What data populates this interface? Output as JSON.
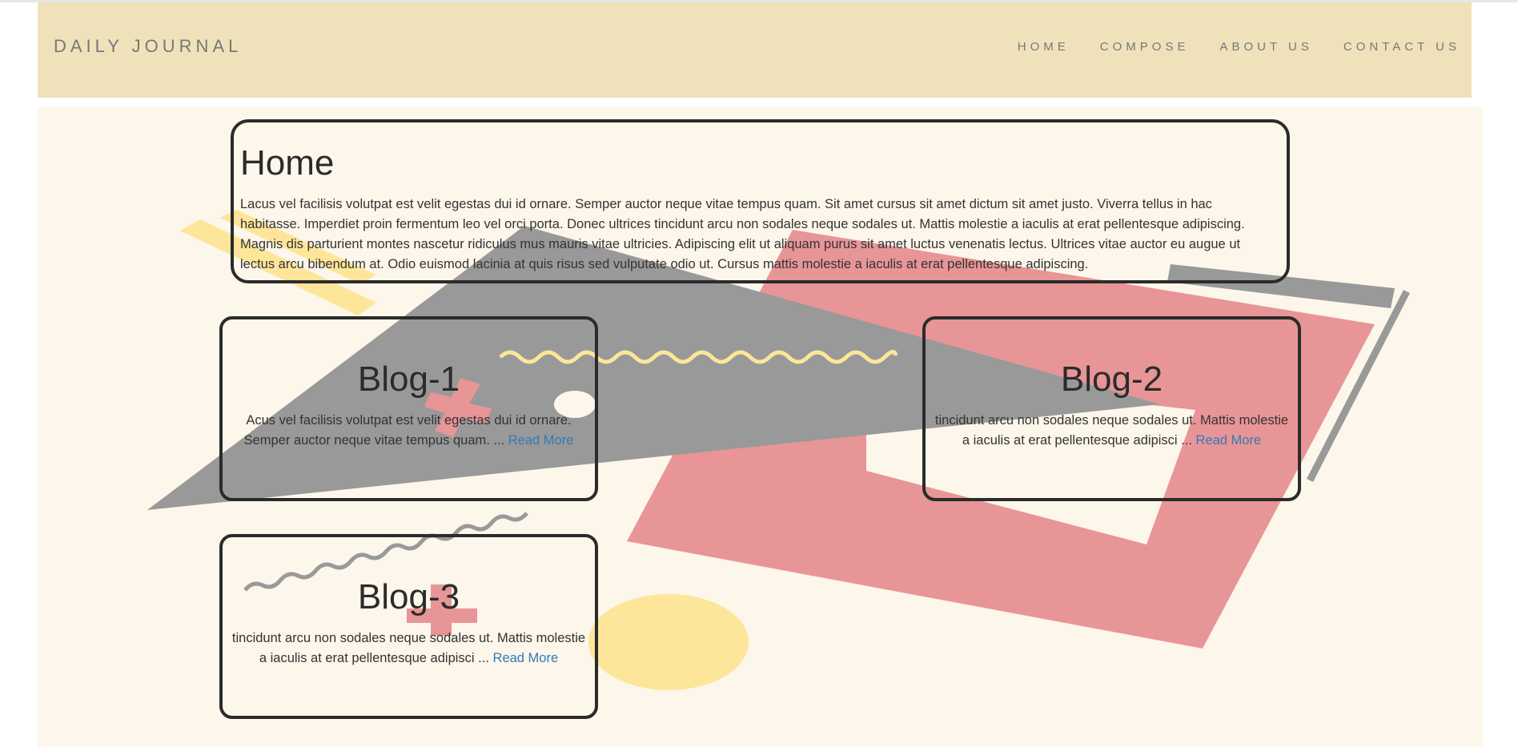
{
  "brand": "DAILY JOURNAL",
  "nav": {
    "items": [
      {
        "label": "HOME"
      },
      {
        "label": "COMPOSE"
      },
      {
        "label": "ABOUT US"
      },
      {
        "label": "CONTACT US"
      }
    ]
  },
  "home": {
    "title": "Home",
    "text": "Lacus vel facilisis volutpat est velit egestas dui id ornare. Semper auctor neque vitae tempus quam. Sit amet cursus sit amet dictum sit amet justo. Viverra tellus in hac habitasse. Imperdiet proin fermentum leo vel orci porta. Donec ultrices tincidunt arcu non sodales neque sodales ut. Mattis molestie a iaculis at erat pellentesque adipiscing. Magnis dis parturient montes nascetur ridiculus mus mauris vitae ultricies. Adipiscing elit ut aliquam purus sit amet luctus venenatis lectus. Ultrices vitae auctor eu augue ut lectus arcu bibendum at. Odio euismod lacinia at quis risus sed vulputate odio ut. Cursus mattis molestie a iaculis at erat pellentesque adipiscing."
  },
  "posts": [
    {
      "title": "Blog-1",
      "excerpt": "Acus vel facilisis volutpat est velit egestas dui id ornare. Semper auctor neque vitae tempus quam. ...",
      "read_more": "Read More"
    },
    {
      "title": "Blog-2",
      "excerpt": "tincidunt arcu non sodales neque sodales ut. Mattis molestie a iaculis at erat pellentesque adipisci ...",
      "read_more": "Read More"
    },
    {
      "title": "Blog-3",
      "excerpt": "tincidunt arcu non sodales neque sodales ut. Mattis molestie a iaculis at erat pellentesque adipisci ...",
      "read_more": "Read More"
    }
  ],
  "colors": {
    "navbar_bg": "#efe2bb",
    "page_bg": "#fdf6ea",
    "shape_gray": "#999999",
    "shape_pink": "#e89597",
    "shape_yellow": "#fde59a",
    "link": "#337ab7"
  }
}
